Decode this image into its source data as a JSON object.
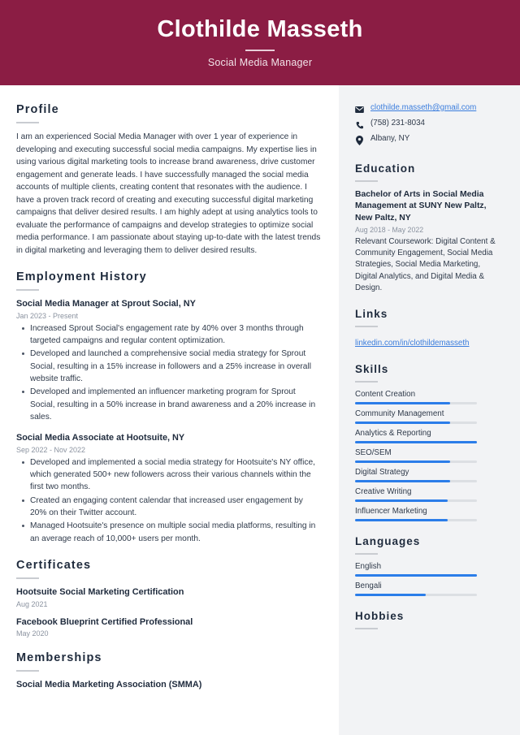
{
  "header": {
    "name": "Clothilde Masseth",
    "job_title": "Social Media Manager",
    "bg_color": "#8b1d44"
  },
  "main": {
    "profile": {
      "heading": "Profile",
      "text": "I am an experienced Social Media Manager with over 1 year of experience in developing and executing successful social media campaigns. My expertise lies in using various digital marketing tools to increase brand awareness, drive customer engagement and generate leads. I have successfully managed the social media accounts of multiple clients, creating content that resonates with the audience. I have a proven track record of creating and executing successful digital marketing campaigns that deliver desired results. I am highly adept at using analytics tools to evaluate the performance of campaigns and develop strategies to optimize social media performance. I am passionate about staying up-to-date with the latest trends in digital marketing and leveraging them to deliver desired results."
    },
    "employment": {
      "heading": "Employment History",
      "jobs": [
        {
          "title": "Social Media Manager at Sprout Social, NY",
          "date": "Jan 2023 - Present",
          "bullets": [
            "Increased Sprout Social's engagement rate by 40% over 3 months through targeted campaigns and regular content optimization.",
            "Developed and launched a comprehensive social media strategy for Sprout Social, resulting in a 15% increase in followers and a 25% increase in overall website traffic.",
            "Developed and implemented an influencer marketing program for Sprout Social, resulting in a 50% increase in brand awareness and a 20% increase in sales."
          ]
        },
        {
          "title": "Social Media Associate at Hootsuite, NY",
          "date": "Sep 2022 - Nov 2022",
          "bullets": [
            "Developed and implemented a social media strategy for Hootsuite's NY office, which generated 500+ new followers across their various channels within the first two months.",
            "Created an engaging content calendar that increased user engagement by 20% on their Twitter account.",
            "Managed Hootsuite's presence on multiple social media platforms, resulting in an average reach of 10,000+ users per month."
          ]
        }
      ]
    },
    "certificates": {
      "heading": "Certificates",
      "items": [
        {
          "title": "Hootsuite Social Marketing Certification",
          "date": "Aug 2021"
        },
        {
          "title": "Facebook Blueprint Certified Professional",
          "date": "May 2020"
        }
      ]
    },
    "memberships": {
      "heading": "Memberships",
      "items": [
        {
          "title": "Social Media Marketing Association (SMMA)"
        }
      ]
    }
  },
  "sidebar": {
    "contact": [
      {
        "icon": "envelope-icon",
        "text": "clothilde.masseth@gmail.com",
        "is_link": true
      },
      {
        "icon": "phone-icon",
        "text": "(758) 231-8034",
        "is_link": false
      },
      {
        "icon": "location-pin-icon",
        "text": "Albany, NY",
        "is_link": false
      }
    ],
    "education": {
      "heading": "Education",
      "degree": "Bachelor of Arts in Social Media Management at SUNY New Paltz, New Paltz, NY",
      "date": "Aug 2018 - May 2022",
      "description": "Relevant Coursework: Digital Content & Community Engagement, Social Media Strategies, Social Media Marketing, Digital Analytics, and Digital Media & Design."
    },
    "links": {
      "heading": "Links",
      "items": [
        {
          "label": "linkedin.com/in/clothildemasseth"
        }
      ]
    },
    "skills": {
      "heading": "Skills",
      "items": [
        {
          "label": "Content Creation",
          "level": 78
        },
        {
          "label": "Community Management",
          "level": 78
        },
        {
          "label": "Analytics & Reporting",
          "level": 100
        },
        {
          "label": "SEO/SEM",
          "level": 78
        },
        {
          "label": "Digital Strategy",
          "level": 78
        },
        {
          "label": "Creative Writing",
          "level": 76
        },
        {
          "label": "Influencer Marketing",
          "level": 76
        }
      ]
    },
    "languages": {
      "heading": "Languages",
      "items": [
        {
          "label": "English",
          "level": 100
        },
        {
          "label": "Bengali",
          "level": 58
        }
      ]
    },
    "hobbies": {
      "heading": "Hobbies"
    },
    "accent_color": "#2b7de9",
    "bg_color": "#f2f3f5"
  }
}
